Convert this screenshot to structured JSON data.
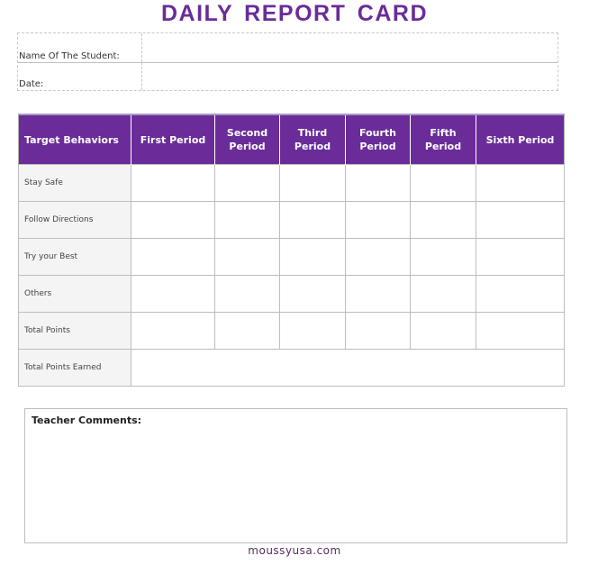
{
  "title": "DAILY REPORT CARD",
  "info": {
    "student_label": "Name Of The Student:",
    "student_value": "",
    "date_label": "Date:",
    "date_value": ""
  },
  "table": {
    "headers": [
      "Target Behaviors",
      "First Period",
      "Second Period",
      "Third Period",
      "Fourth Period",
      "Fifth Period",
      "Sixth Period"
    ],
    "rows": [
      {
        "label": "Stay Safe",
        "cells": [
          "",
          "",
          "",
          "",
          "",
          ""
        ]
      },
      {
        "label": "Follow Directions",
        "cells": [
          "",
          "",
          "",
          "",
          "",
          ""
        ]
      },
      {
        "label": "Try your Best",
        "cells": [
          "",
          "",
          "",
          "",
          "",
          ""
        ]
      },
      {
        "label": "Others",
        "cells": [
          "",
          "",
          "",
          "",
          "",
          ""
        ]
      },
      {
        "label": "Total Points",
        "cells": [
          "",
          "",
          "",
          "",
          "",
          ""
        ]
      }
    ],
    "total_row": {
      "label": "Total Points Earned",
      "value": ""
    }
  },
  "comments": {
    "label": "Teacher Comments:",
    "value": ""
  },
  "footer": "moussyusa.com",
  "colors": {
    "accent": "#6a2c99",
    "label_bg": "#f4f4f4",
    "border": "#bdbdbd"
  }
}
